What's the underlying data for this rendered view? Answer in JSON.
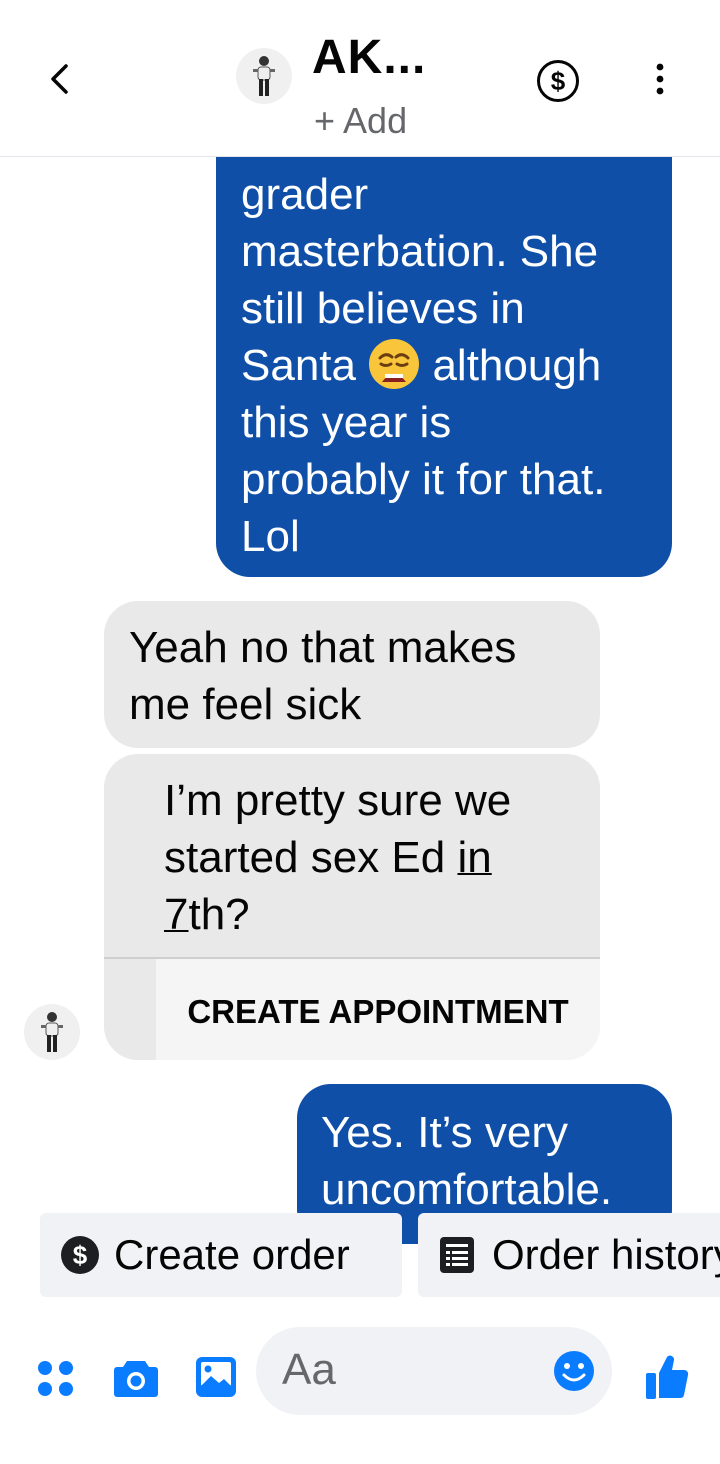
{
  "header": {
    "name": "AK...",
    "add_label": "+ Add"
  },
  "messages": {
    "outgoing_1": {
      "lines": [
        "grader",
        "masterbation.  She",
        "still believes in",
        "Santa",
        "although",
        "this year is",
        "probably it for that.",
        "Lol"
      ],
      "emoji": "weary-face"
    },
    "incoming_1": {
      "lines": [
        "Yeah no that makes",
        "me feel sick"
      ]
    },
    "incoming_card": {
      "line1": "I’m pretty sure we",
      "line2_prefix": "started sex Ed ",
      "line2_link": "in",
      "line3_link": "7",
      "line3_suffix": "th?",
      "button_label": "CREATE APPOINTMENT"
    },
    "outgoing_2": {
      "lines": [
        "Yes. It’s very",
        "uncomfortable."
      ]
    }
  },
  "quick_replies": [
    {
      "label": "Create order",
      "icon": "dollar-circle-icon"
    },
    {
      "label": "Order history",
      "icon": "receipt-icon"
    }
  ],
  "composer": {
    "placeholder": "Aa"
  },
  "colors": {
    "outgoing_bubble": "#0f4fa8",
    "incoming_bubble": "#e9e9e9",
    "accent": "#0a7cff"
  }
}
